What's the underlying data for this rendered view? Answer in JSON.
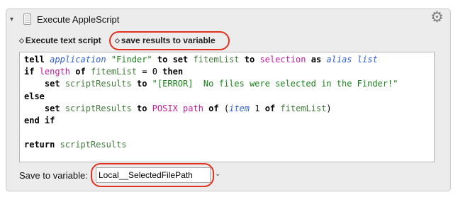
{
  "action": {
    "title": "Execute AppleScript",
    "disclosure_glyph": "▾",
    "gear_glyph": "⚙",
    "icon_names": {
      "disclosure": "chevron-down-icon",
      "action": "script-icon",
      "gear": "gear-icon"
    }
  },
  "options": {
    "mode_label": "Execute text script",
    "output_label": "save results to variable",
    "popup_glyph": "⌃⌄"
  },
  "script": {
    "lines": [
      "tell application \"Finder\" to set fitemList to selection as alias list",
      "if length of fitemList = 0 then",
      "    set scriptResults to \"[ERROR]  No files were selected in the Finder!\"",
      "else",
      "    set scriptResults to POSIX path of (item 1 of fitemList)",
      "end if",
      "",
      "return scriptResults"
    ]
  },
  "save": {
    "label": "Save to variable:",
    "variable_value": "Local__SelectedFilePath",
    "dropdown_glyph": "⌄"
  },
  "colors": {
    "highlight": "#e0321e",
    "keyword": "#000000",
    "application": "#2d5ed1",
    "string": "#187f18",
    "variable": "#427a3b",
    "property": "#c41a9c"
  }
}
